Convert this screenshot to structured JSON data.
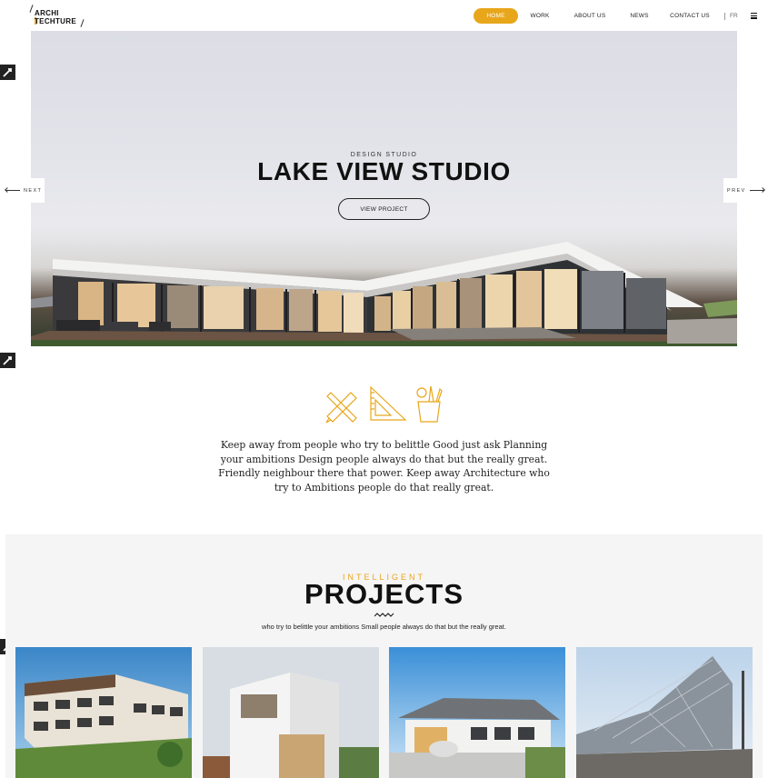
{
  "logo": {
    "line1": "ARCHI",
    "line2": "TECHTURE"
  },
  "nav": {
    "items": [
      "HOME",
      "WORK",
      "ABOUT US",
      "NEWS",
      "CONTACT US"
    ],
    "lang": "FR",
    "accent": "#e8a61a"
  },
  "hero": {
    "kicker": "DESIGN STUDIO",
    "title": "LAKE VIEW STUDIO",
    "button": "VIEW PROJECT",
    "next": "NEXT",
    "prev": "PREV"
  },
  "icons": [
    "pencil-ruler-icon",
    "set-square-icon",
    "drawing-tools-cup-icon",
    "edit-icon",
    "menu-icon"
  ],
  "intro": {
    "text": "Keep away from people who try to belittle Good just ask Planning your ambitions Design people always do that but the really great. Friendly neighbour there that power. Keep away Architecture who try to Ambitions people do that really great."
  },
  "projects": {
    "kicker": "INTELLIGENT",
    "title": "PROJECTS",
    "subtitle": "who try to belittle your ambitions Small people always do that but the really great."
  }
}
